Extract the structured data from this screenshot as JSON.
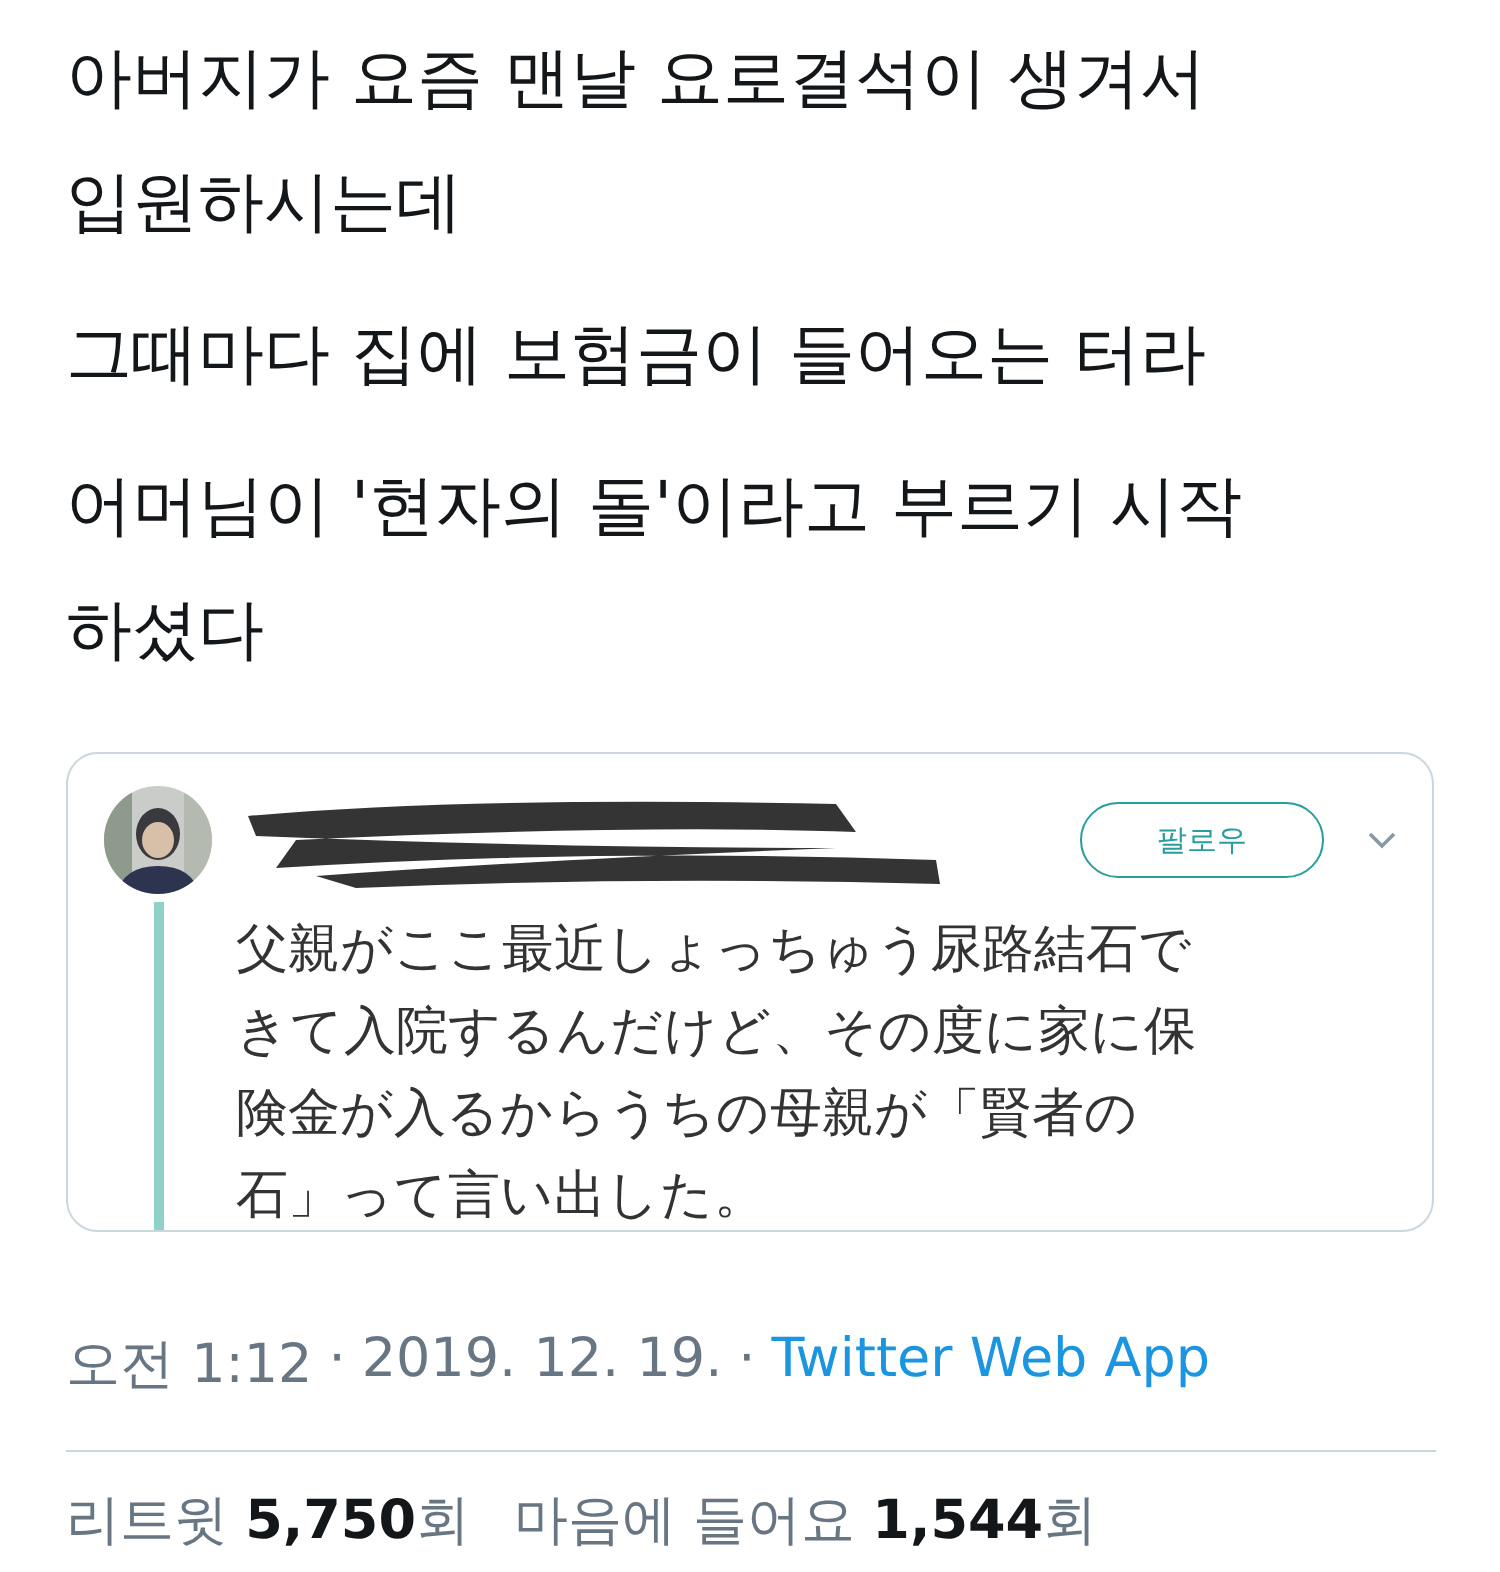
{
  "tweet_text": [
    {
      "lines": [
        "아버지가 요즘 맨날 요로결석이 생겨서",
        "입원하시는데"
      ]
    },
    {
      "lines": [
        "그때마다 집에 보험금이 들어오는 터라"
      ]
    },
    {
      "lines": [
        "어머님이 '현자의 돌'이라고 부르기 시작",
        "하셨다"
      ]
    }
  ],
  "embedded_image": {
    "name_redacted": true,
    "follow_button": "팔로우",
    "text_lines": [
      "父親がここ最近しょっちゅう尿路結石で",
      "きて入院するんだけど、その度に家に保",
      "険金が入るからうちの母親が「賢者の",
      "石」って言い出した。"
    ]
  },
  "timestamp": {
    "time": "오전 1:12",
    "separator": "·",
    "date": "2019. 12. 19.",
    "source": "Twitter Web App"
  },
  "stats": [
    {
      "label": "리트윗",
      "count": "5,750",
      "unit": "회"
    },
    {
      "label": "마음에 들어요",
      "count": "1,544",
      "unit": "회"
    }
  ]
}
